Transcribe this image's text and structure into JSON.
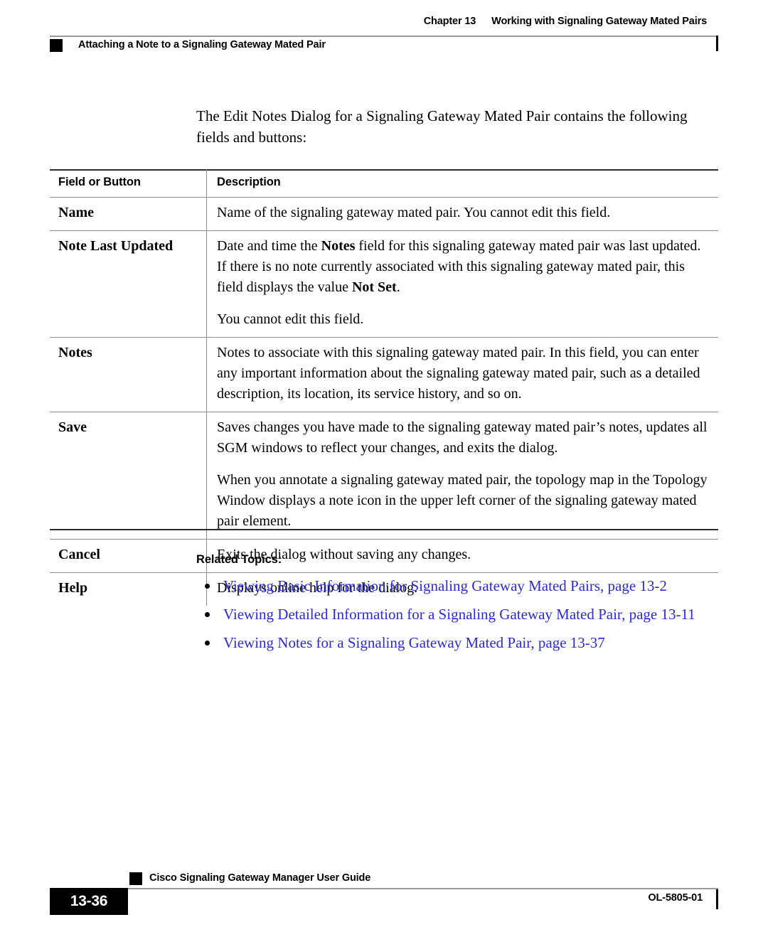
{
  "header": {
    "chapter_label": "Chapter 13",
    "chapter_title": "Working with Signaling Gateway Mated Pairs",
    "running_head": "Attaching a Note to a Signaling Gateway Mated Pair"
  },
  "intro": {
    "text": "The Edit Notes Dialog for a Signaling Gateway Mated Pair contains the following fields and buttons:"
  },
  "table": {
    "headers": {
      "col1": "Field or Button",
      "col2": "Description"
    },
    "rows": [
      {
        "label": "Name",
        "paragraphs": [
          "Name of the signaling gateway mated pair. You cannot edit this field."
        ]
      },
      {
        "label": "Note Last Updated",
        "paragraphs": [
          "Date and time the Notes field for this signaling gateway mated pair was last updated. If there is no note currently associated with this signaling gateway mated pair, this field displays the value Not Set.",
          "You cannot edit this field."
        ],
        "bold_runs": [
          "Notes",
          "Not Set"
        ]
      },
      {
        "label": "Notes",
        "paragraphs": [
          "Notes to associate with this signaling gateway mated pair. In this field, you can enter any important information about the signaling gateway mated pair, such as a detailed description, its location, its service history, and so on."
        ]
      },
      {
        "label": "Save",
        "paragraphs": [
          "Saves changes you have made to the signaling gateway mated pair’s notes, updates all SGM windows to reflect your changes, and exits the dialog.",
          "When you annotate a signaling gateway mated pair, the topology map in the Topology Window displays a note icon in the upper left corner of the signaling gateway mated pair element."
        ]
      },
      {
        "label": "Cancel",
        "paragraphs": [
          "Exits the dialog without saving any changes."
        ]
      },
      {
        "label": "Help",
        "paragraphs": [
          "Displays online help for the dialog."
        ]
      }
    ]
  },
  "related_topics": {
    "heading": "Related Topics:",
    "link_color": "#2a2ad6",
    "links": [
      "Viewing Basic Information for Signaling Gateway Mated Pairs, page 13-2",
      "Viewing Detailed Information for a Signaling Gateway Mated Pair, page 13-11",
      "Viewing Notes for a Signaling Gateway Mated Pair, page 13-37"
    ]
  },
  "footer": {
    "guide_title": "Cisco Signaling Gateway Manager User Guide",
    "page_number": "13-36",
    "doc_id": "OL-5805-01"
  }
}
